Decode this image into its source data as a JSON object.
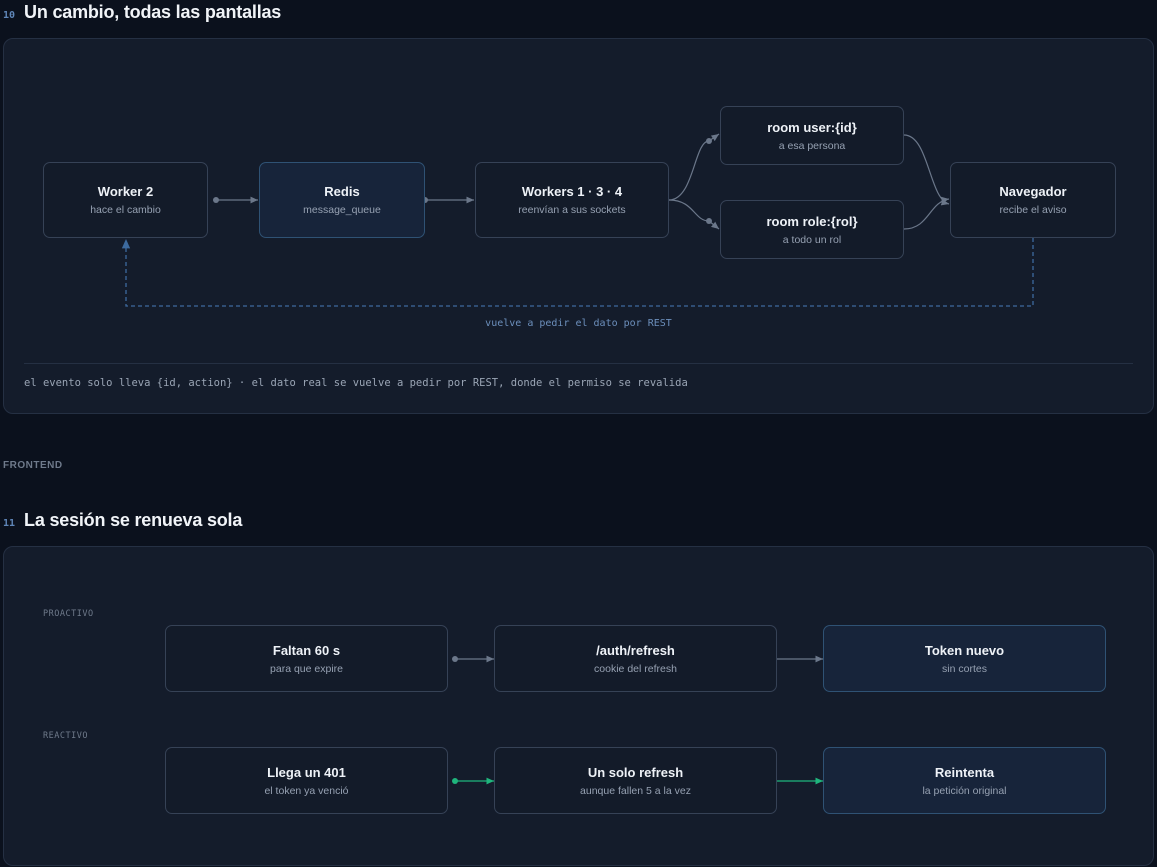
{
  "section10": {
    "number": "10",
    "title": "Un cambio, todas las pantallas",
    "nodes": [
      {
        "title": "Worker 2",
        "sub": "hace el cambio"
      },
      {
        "title": "Redis",
        "sub": "message_queue"
      },
      {
        "title": "Workers 1 · 3 · 4",
        "sub": "reenvían a sus sockets"
      },
      {
        "title": "room user:{id}",
        "sub": "a esa persona"
      },
      {
        "title": "room role:{rol}",
        "sub": "a todo un rol"
      },
      {
        "title": "Navegador",
        "sub": "recibe el aviso"
      }
    ],
    "loop_label": "vuelve a pedir el dato por REST",
    "note": "el evento solo lleva {id, action} · el dato real se vuelve a pedir por REST, donde el permiso se revalida"
  },
  "group_label": "FRONTEND",
  "section11": {
    "number": "11",
    "title": "La sesión se renueva sola",
    "rows": [
      {
        "label": "PROACTIVO",
        "nodes": [
          {
            "title": "Faltan 60 s",
            "sub": "para que expire"
          },
          {
            "title": "/auth/refresh",
            "sub": "cookie del refresh"
          },
          {
            "title": "Token nuevo",
            "sub": "sin cortes"
          }
        ]
      },
      {
        "label": "REACTIVO",
        "nodes": [
          {
            "title": "Llega un 401",
            "sub": "el token ya venció"
          },
          {
            "title": "Un solo refresh",
            "sub": "aunque fallen 5 a la vez"
          },
          {
            "title": "Reintenta",
            "sub": "la petición original"
          }
        ]
      }
    ]
  },
  "colors": {
    "background": "#0b111d",
    "panel": "#141c2b",
    "arrow_gray": "#6b778a",
    "arrow_green": "#1fb57d",
    "loop_blue": "#3d6a9e",
    "accent_number": "#5f86b8"
  }
}
